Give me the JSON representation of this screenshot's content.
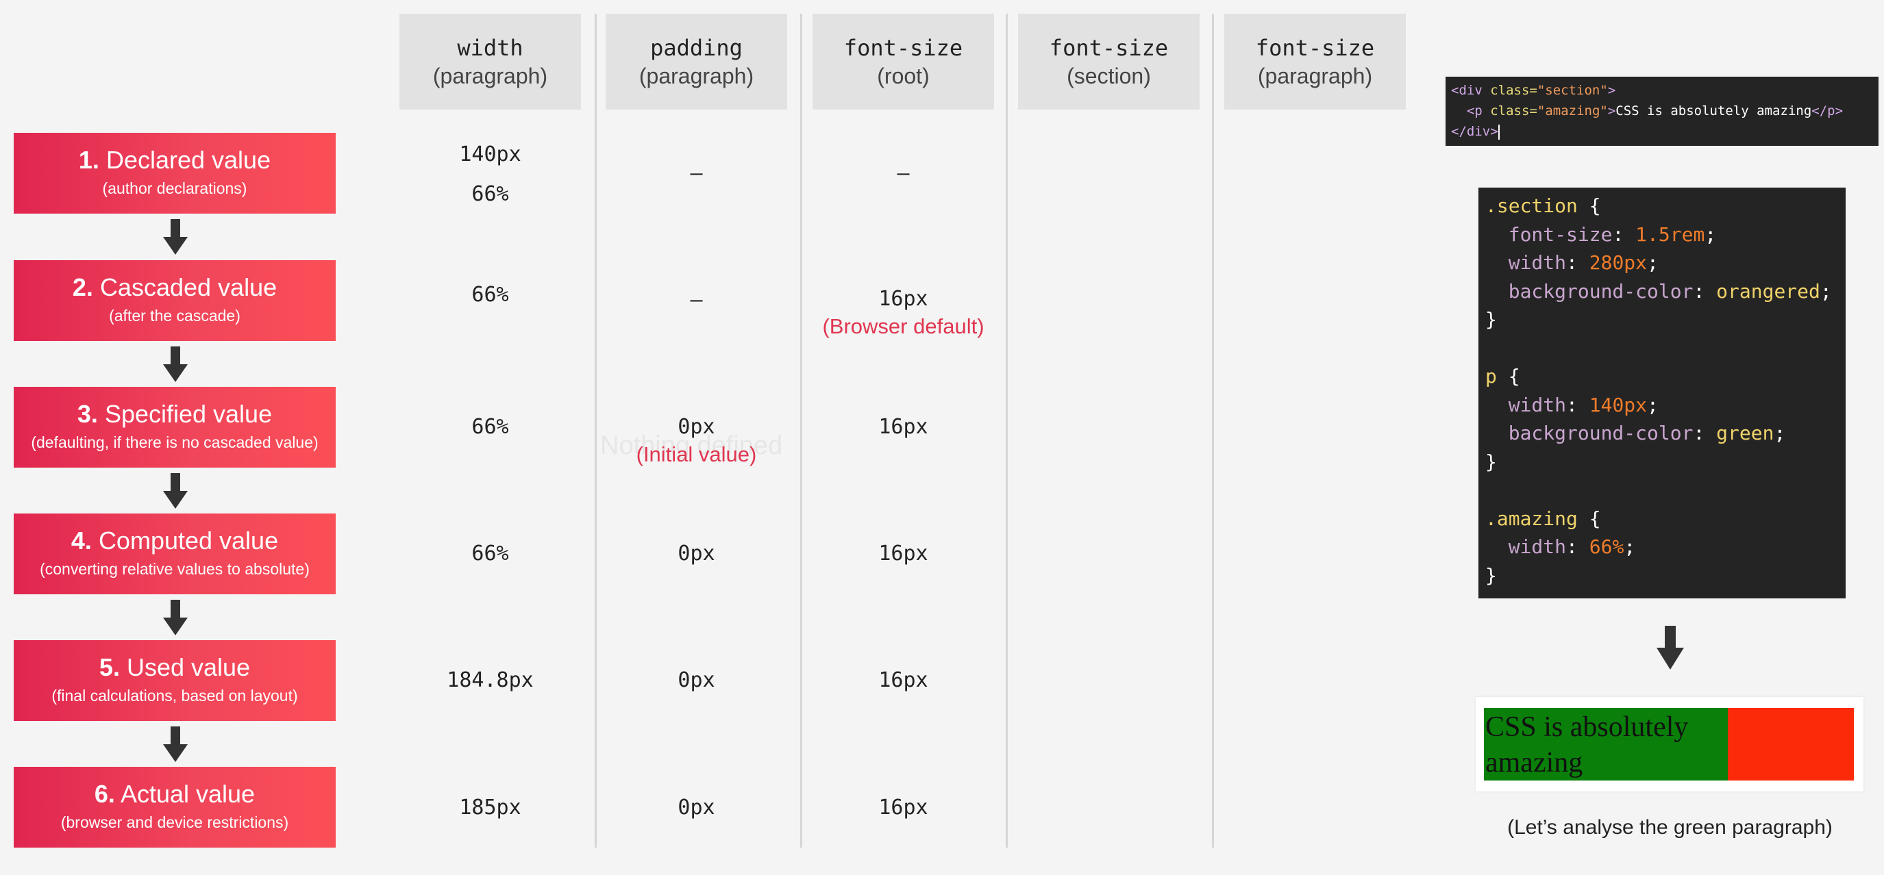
{
  "steps": [
    {
      "num": "1.",
      "title": "Declared value",
      "sub": "(author declarations)"
    },
    {
      "num": "2.",
      "title": "Cascaded value",
      "sub": "(after the cascade)"
    },
    {
      "num": "3.",
      "title": "Specified value",
      "sub": "(defaulting, if there is no cascaded value)"
    },
    {
      "num": "4.",
      "title": "Computed value",
      "sub": "(converting relative values to absolute)"
    },
    {
      "num": "5.",
      "title": "Used value",
      "sub": "(final calculations, based on layout)"
    },
    {
      "num": "6.",
      "title": "Actual value",
      "sub": "(browser and device restrictions)"
    }
  ],
  "columns": [
    {
      "prop": "width",
      "ctx": "(paragraph)"
    },
    {
      "prop": "padding",
      "ctx": "(paragraph)"
    },
    {
      "prop": "font-size",
      "ctx": "(root)"
    },
    {
      "prop": "font-size",
      "ctx": "(section)"
    },
    {
      "prop": "font-size",
      "ctx": "(paragraph)"
    }
  ],
  "values": {
    "width": {
      "declared_a": "140px",
      "declared_b": "66%",
      "cascaded": "66%",
      "specified": "66%",
      "computed": "66%",
      "used": "184.8px",
      "actual": "185px"
    },
    "padding": {
      "declared": "–",
      "cascaded": "–",
      "specified": "0px",
      "specified_note": "(Initial value)",
      "computed": "0px",
      "used": "0px",
      "actual": "0px"
    },
    "font_root": {
      "declared": "–",
      "cascaded": "16px",
      "cascaded_note": "(Browser default)",
      "specified": "16px",
      "computed": "16px",
      "used": "16px",
      "actual": "16px"
    }
  },
  "ghost_text": "Nothing defined",
  "html_code": {
    "open_tag": "<div",
    "class_attr": "class=",
    "section_str": "\"section\"",
    "p_open": "<p",
    "amazing_str": "\"amazing\"",
    "paragraph_text": "CSS is absolutely amazing",
    "p_close": "</p>",
    "div_close": "</div>",
    "gt": ">"
  },
  "css_code": {
    "sel_section": ".section",
    "sel_p": "p",
    "sel_amazing": ".amazing",
    "open_brace": "{",
    "close_brace": "}",
    "prop_font_size": "font-size",
    "prop_width": "width",
    "prop_bg": "background-color",
    "val_1_5rem": "1.5rem",
    "val_280px": "280px",
    "val_orangered": "orangered",
    "val_140px": "140px",
    "val_green": "green",
    "val_66pct": "66%",
    "colon": ": ",
    "semi": ";"
  },
  "preview": {
    "text": "CSS is absolutely amazing",
    "section_color": "#fd2a09",
    "paragraph_color": "#0a800a"
  },
  "caption": "(Let’s analyse the green paragraph)",
  "colors": {
    "accent_red": "#e0354f",
    "step_gradient_start": "#e0254f",
    "step_gradient_end": "#fb4f57",
    "code_bg": "#242424"
  }
}
